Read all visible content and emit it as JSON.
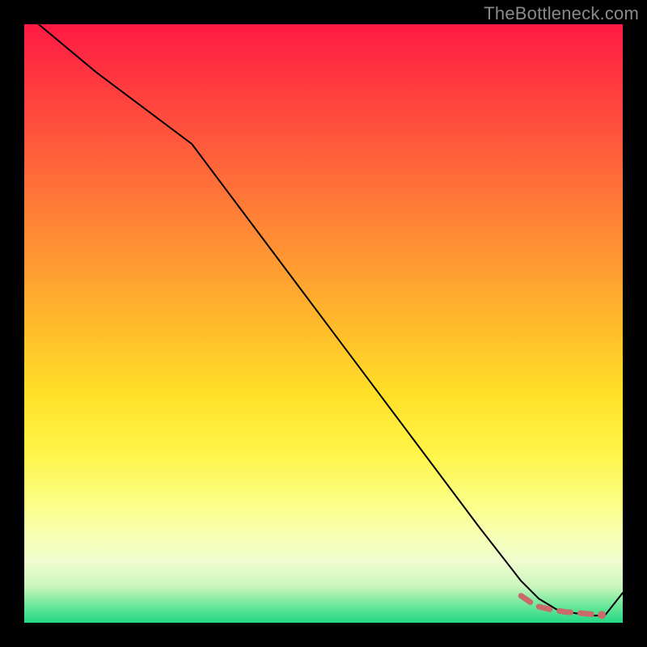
{
  "watermark": "TheBottleneck.com",
  "colors": {
    "background": "#000000",
    "line": "#000000",
    "dashed": "#c96b6b",
    "dot": "#c96b6b",
    "gradient_stops": [
      "#ff1a44",
      "#ff3a3f",
      "#ff6a3a",
      "#ff9a32",
      "#ffc02a",
      "#ffe028",
      "#fff54a",
      "#fcff86",
      "#f6ffb8",
      "#effcd0",
      "#c9f5bc",
      "#6fe89b",
      "#23d884"
    ]
  },
  "chart_data": {
    "type": "line",
    "title": "",
    "xlabel": "",
    "ylabel": "",
    "xlim": [
      0,
      100
    ],
    "ylim": [
      0,
      100
    ],
    "grid": false,
    "series": [
      {
        "name": "bottleneck-curve",
        "style": "solid",
        "x": [
          0,
          12,
          28,
          40,
          52,
          64,
          76,
          83,
          86,
          89,
          92,
          95,
          97,
          100
        ],
        "values": [
          102,
          92,
          80,
          64,
          48,
          32,
          16,
          7,
          4,
          2.2,
          1.6,
          1.2,
          1.2,
          5
        ]
      },
      {
        "name": "optimal-region",
        "style": "dashed",
        "x": [
          83,
          85.5,
          88,
          90.5,
          93,
          95,
          96.5
        ],
        "values": [
          4.5,
          2.8,
          2.2,
          1.8,
          1.6,
          1.4,
          1.3
        ]
      }
    ],
    "annotations": [
      {
        "name": "optimal-point",
        "x": 96.5,
        "y": 1.3
      }
    ]
  }
}
